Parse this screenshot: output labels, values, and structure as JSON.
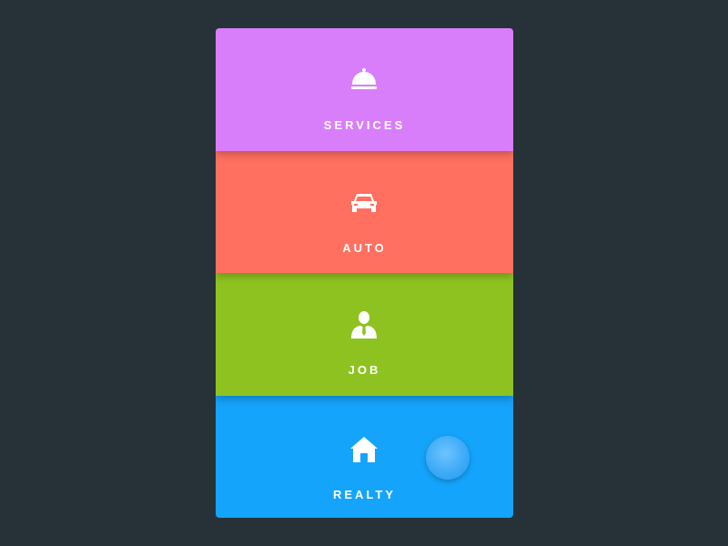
{
  "categories": [
    {
      "label": "SERVICES",
      "icon": "cloche-icon",
      "color": "#D97EFB"
    },
    {
      "label": "AUTO",
      "icon": "car-icon",
      "color": "#FF7060"
    },
    {
      "label": "JOB",
      "icon": "person-tie-icon",
      "color": "#8EC221"
    },
    {
      "label": "REALTY",
      "icon": "house-icon",
      "color": "#14A4FB"
    }
  ],
  "fab": {
    "icon": "touch-indicator",
    "color": "#3AA9F7"
  }
}
